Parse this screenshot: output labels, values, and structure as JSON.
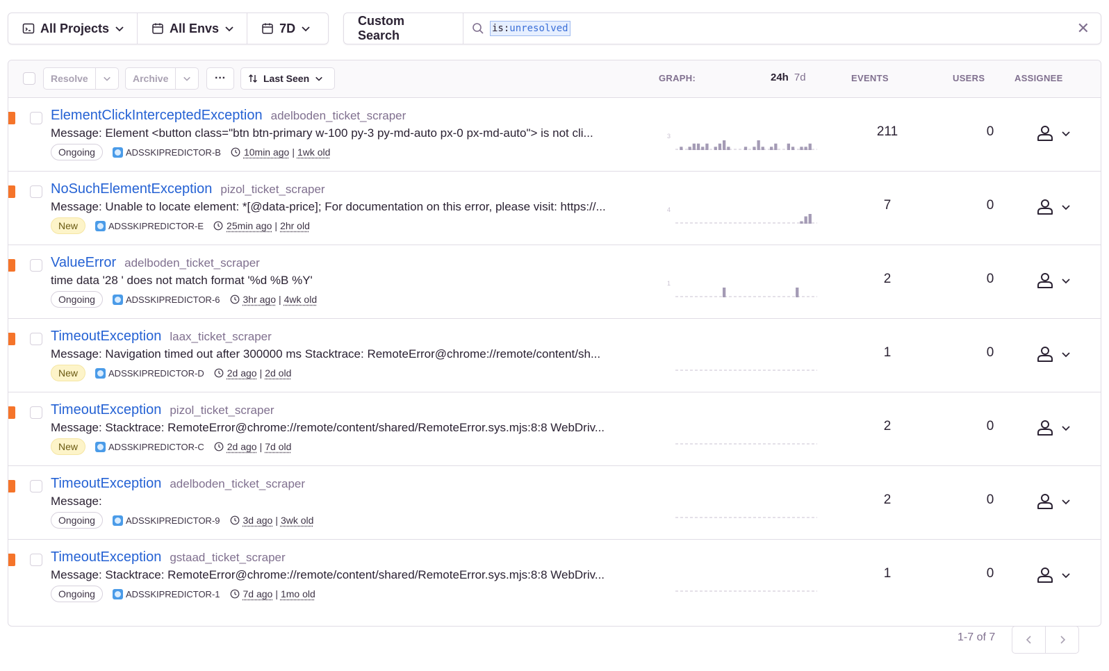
{
  "filters": {
    "projects": "All Projects",
    "envs": "All Envs",
    "period": "7D"
  },
  "search": {
    "label": "Custom Search",
    "token_key": "is:",
    "token_value": "unresolved"
  },
  "toolbar": {
    "resolve": "Resolve",
    "archive": "Archive",
    "more": "···",
    "sort": "Last Seen"
  },
  "columns": {
    "graph": "GRAPH:",
    "period_24h": "24h",
    "period_7d": "7d",
    "events": "EVENTS",
    "users": "USERS",
    "assignee": "ASSIGNEE"
  },
  "colors": {
    "accent_link": "#2562d4",
    "level_bar": "#f5742a",
    "new_badge_bg": "#fdf4c9"
  },
  "issues": [
    {
      "title": "ElementClickInterceptedException",
      "culprit": "adelboden_ticket_scraper",
      "message": "Message: Element <button class=\"btn btn-primary w-100 py-3 py-md-auto px-0 px-md-auto\"> is not cli...",
      "status": "Ongoing",
      "short_id": "ADSSKIPREDICTOR-B",
      "last_seen": "10min ago",
      "age": "1wk old",
      "events": "211",
      "users": "0",
      "spark_max": "3",
      "spark": [
        0,
        1,
        0,
        1,
        2,
        2,
        1,
        2,
        0,
        1,
        2,
        3,
        1,
        0,
        0,
        0,
        1,
        0,
        1,
        3,
        1,
        0,
        1,
        2,
        0,
        0,
        2,
        1,
        0,
        1,
        1,
        2,
        0
      ]
    },
    {
      "title": "NoSuchElementException",
      "culprit": "pizol_ticket_scraper",
      "message": "Message: Unable to locate element: *[@data-price]; For documentation on this error, please visit: https://...",
      "status": "New",
      "short_id": "ADSSKIPREDICTOR-E",
      "last_seen": "25min ago",
      "age": "2hr old",
      "events": "7",
      "users": "0",
      "spark_max": "4",
      "spark": [
        0,
        0,
        0,
        0,
        0,
        0,
        0,
        0,
        0,
        0,
        0,
        0,
        0,
        0,
        0,
        0,
        0,
        0,
        0,
        0,
        0,
        0,
        0,
        0,
        0,
        0,
        0,
        0,
        0,
        1,
        3,
        4,
        0
      ]
    },
    {
      "title": "ValueError",
      "culprit": "adelboden_ticket_scraper",
      "message": "time data '28 ' does not match format '%d %B %Y'",
      "status": "Ongoing",
      "short_id": "ADSSKIPREDICTOR-6",
      "last_seen": "3hr ago",
      "age": "4wk old",
      "events": "2",
      "users": "0",
      "spark_max": "1",
      "spark": [
        0,
        0,
        0,
        0,
        0,
        0,
        0,
        0,
        0,
        0,
        0,
        1,
        0,
        0,
        0,
        0,
        0,
        0,
        0,
        0,
        0,
        0,
        0,
        0,
        0,
        0,
        0,
        0,
        1,
        0,
        0,
        0,
        0
      ]
    },
    {
      "title": "TimeoutException",
      "culprit": "laax_ticket_scraper",
      "message": "Message: Navigation timed out after 300000 ms Stacktrace: RemoteError@chrome://remote/content/sh...",
      "status": "New",
      "short_id": "ADSSKIPREDICTOR-D",
      "last_seen": "2d ago",
      "age": "2d old",
      "events": "1",
      "users": "0",
      "spark_max": "",
      "spark": [
        0,
        0,
        0,
        0,
        0,
        0,
        0,
        0,
        0,
        0,
        0,
        0,
        0,
        0,
        0,
        0,
        0,
        0,
        0,
        0,
        0,
        0,
        0,
        0,
        0,
        0,
        0,
        0,
        0,
        0,
        0,
        0,
        0
      ]
    },
    {
      "title": "TimeoutException",
      "culprit": "pizol_ticket_scraper",
      "message": "Message: Stacktrace: RemoteError@chrome://remote/content/shared/RemoteError.sys.mjs:8:8 WebDriv...",
      "status": "New",
      "short_id": "ADSSKIPREDICTOR-C",
      "last_seen": "2d ago",
      "age": "7d old",
      "events": "2",
      "users": "0",
      "spark_max": "",
      "spark": [
        0,
        0,
        0,
        0,
        0,
        0,
        0,
        0,
        0,
        0,
        0,
        0,
        0,
        0,
        0,
        0,
        0,
        0,
        0,
        0,
        0,
        0,
        0,
        0,
        0,
        0,
        0,
        0,
        0,
        0,
        0,
        0,
        0
      ]
    },
    {
      "title": "TimeoutException",
      "culprit": "adelboden_ticket_scraper",
      "message": "Message:",
      "status": "Ongoing",
      "short_id": "ADSSKIPREDICTOR-9",
      "last_seen": "3d ago",
      "age": "3wk old",
      "events": "2",
      "users": "0",
      "spark_max": "",
      "spark": [
        0,
        0,
        0,
        0,
        0,
        0,
        0,
        0,
        0,
        0,
        0,
        0,
        0,
        0,
        0,
        0,
        0,
        0,
        0,
        0,
        0,
        0,
        0,
        0,
        0,
        0,
        0,
        0,
        0,
        0,
        0,
        0,
        0
      ]
    },
    {
      "title": "TimeoutException",
      "culprit": "gstaad_ticket_scraper",
      "message": "Message: Stacktrace: RemoteError@chrome://remote/content/shared/RemoteError.sys.mjs:8:8 WebDriv...",
      "status": "Ongoing",
      "short_id": "ADSSKIPREDICTOR-1",
      "last_seen": "7d ago",
      "age": "1mo old",
      "events": "1",
      "users": "0",
      "spark_max": "",
      "spark": [
        0,
        0,
        0,
        0,
        0,
        0,
        0,
        0,
        0,
        0,
        0,
        0,
        0,
        0,
        0,
        0,
        0,
        0,
        0,
        0,
        0,
        0,
        0,
        0,
        0,
        0,
        0,
        0,
        0,
        0,
        0,
        0,
        0
      ]
    }
  ],
  "pagination": {
    "label": "1-7 of 7"
  }
}
